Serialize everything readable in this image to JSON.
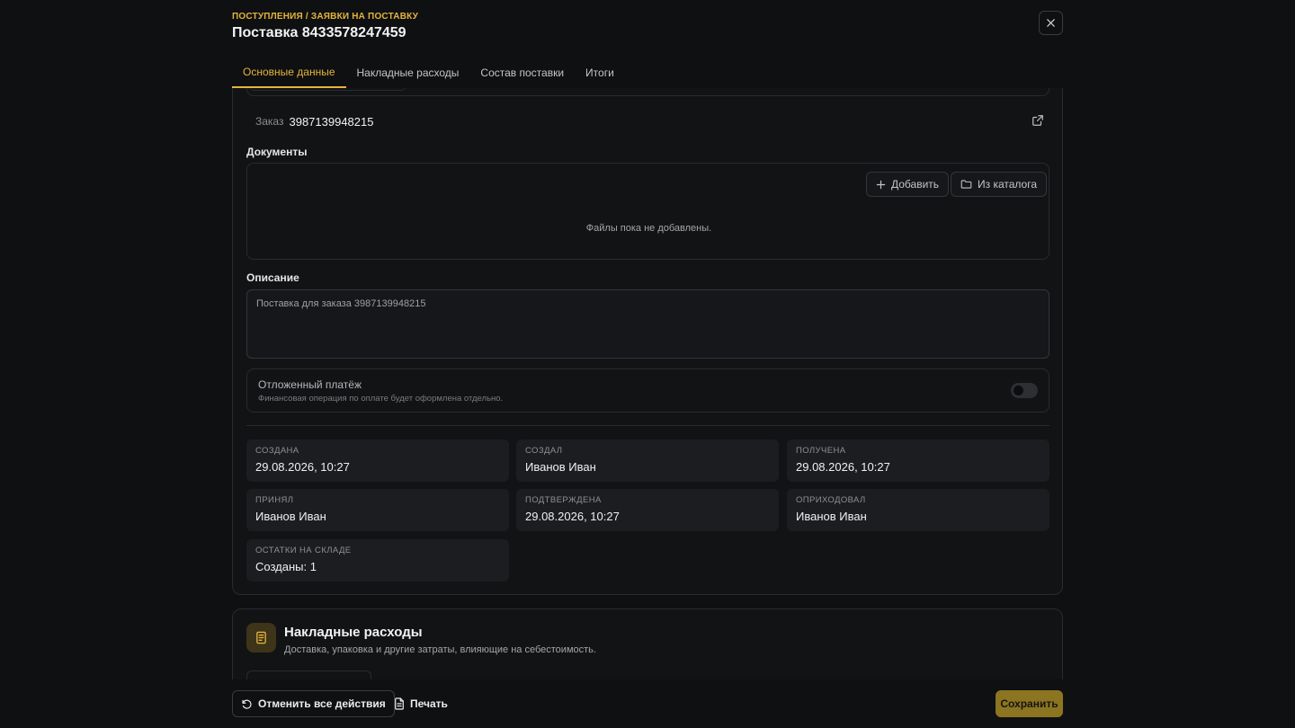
{
  "header": {
    "breadcrumb": "ПОСТУПЛЕНИЯ / ЗАЯВКИ НА ПОСТАВКУ",
    "title": "Поставка 8433578247459"
  },
  "tabs": [
    {
      "label": "Основные данные",
      "active": true
    },
    {
      "label": "Накладные расходы",
      "active": false
    },
    {
      "label": "Состав поставки",
      "active": false
    },
    {
      "label": "Итоги",
      "active": false
    }
  ],
  "order": {
    "label": "Заказ",
    "value": "3987139948215"
  },
  "documents": {
    "label": "Документы",
    "add_label": "Добавить",
    "catalog_label": "Из каталога",
    "empty_text": "Файлы пока не добавлены."
  },
  "description": {
    "label": "Описание",
    "value": "Поставка для заказа 3987139948215"
  },
  "deferred_payment": {
    "title": "Отложенный платёж",
    "subtitle": "Финансовая операция по оплате будет оформлена отдельно.",
    "enabled": false
  },
  "meta": [
    {
      "label": "СОЗДАНА",
      "value": "29.08.2026, 10:27"
    },
    {
      "label": "СОЗДАЛ",
      "value": "Иванов Иван"
    },
    {
      "label": "ПОЛУЧЕНА",
      "value": "29.08.2026, 10:27"
    },
    {
      "label": "ПРИНЯЛ",
      "value": "Иванов Иван"
    },
    {
      "label": "ПОДТВЕРЖДЕНА",
      "value": "29.08.2026, 10:27"
    },
    {
      "label": "ОПРИХОДОВАЛ",
      "value": "Иванов Иван"
    },
    {
      "label": "ОСТАТКИ НА СКЛАДЕ",
      "value": "Созданы: 1"
    }
  ],
  "overhead": {
    "title": "Накладные расходы",
    "subtitle": "Доставка, упаковка и другие затраты, влияющие на себестоимость."
  },
  "footer": {
    "undo_label": "Отменить все действия",
    "print_label": "Печать",
    "save_label": "Сохранить"
  },
  "colors": {
    "accent": "#e3b53a",
    "background": "#0f1012",
    "save_button": "#8c7520"
  },
  "icons": [
    "close-icon",
    "external-link-icon",
    "plus-icon",
    "folder-icon",
    "document-icon",
    "undo-icon",
    "print-icon"
  ]
}
